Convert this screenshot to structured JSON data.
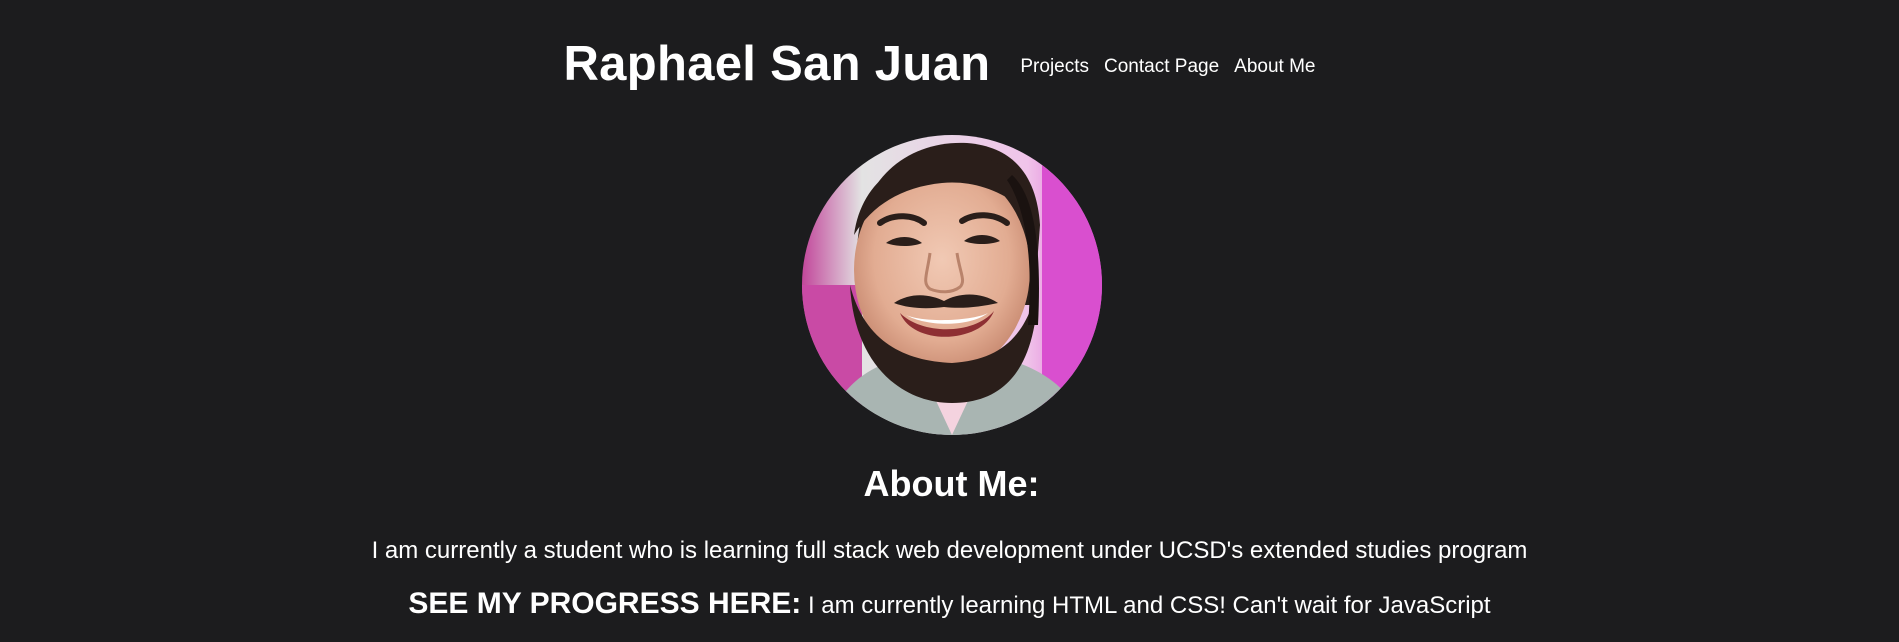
{
  "header": {
    "title": "Raphael San Juan",
    "nav": [
      {
        "label": "Projects"
      },
      {
        "label": "Contact Page"
      },
      {
        "label": "About Me"
      }
    ]
  },
  "profile": {
    "image_alt": "Portrait photo of Raphael San Juan"
  },
  "about": {
    "heading": "About Me:",
    "description": "I am currently a student who is learning full stack web development under UCSD's extended studies program",
    "progress_label": "SEE MY PROGRESS HERE:",
    "progress_text": " I am currently learning HTML and CSS! Can't wait for JavaScript"
  },
  "colors": {
    "background": "#1c1c1e",
    "text": "#ffffff",
    "photo_backdrop": "#d94fcf"
  }
}
